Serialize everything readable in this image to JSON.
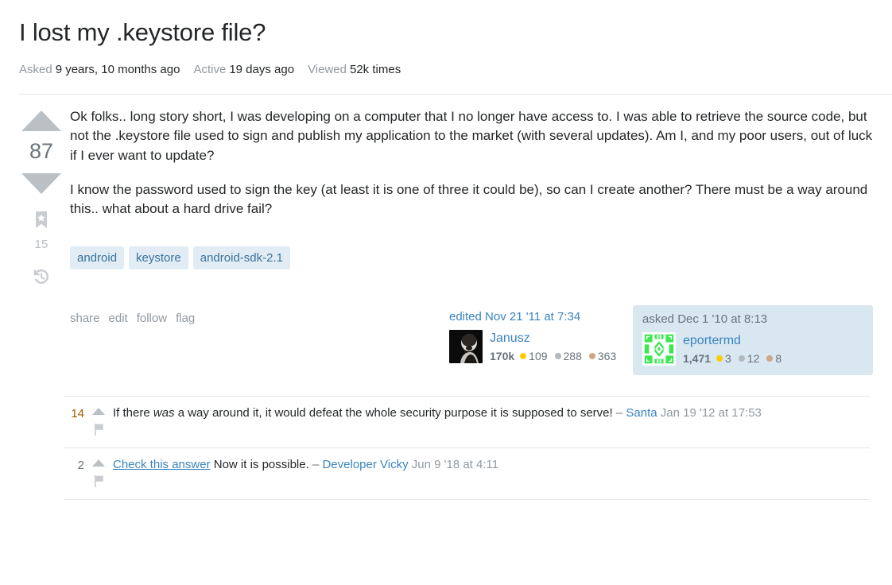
{
  "header": {
    "title": "I lost my .keystore file?",
    "stats": [
      {
        "label": "Asked",
        "value": "9 years, 10 months ago"
      },
      {
        "label": "Active",
        "value": "19 days ago"
      },
      {
        "label": "Viewed",
        "value": "52k times"
      }
    ]
  },
  "vote": {
    "score": "87",
    "bookmark_count": "15",
    "up_icon": "upvote-arrow-icon",
    "down_icon": "downvote-arrow-icon",
    "bookmark_icon": "bookmark-star-icon",
    "history_icon": "history-clock-icon"
  },
  "post": {
    "paragraphs": [
      "Ok folks.. long story short, I was developing on a computer that I no longer have access to. I was able to retrieve the source code, but not the .keystore file used to sign and publish my application to the market (with several updates). Am I, and my poor users, out of luck if I ever want to update?",
      "I know the password used to sign the key (at least it is one of three it could be), so can I create another? There must be a way around this.. what about a hard drive fail?"
    ],
    "tags": [
      "android",
      "keystore",
      "android-sdk-2.1"
    ],
    "actions": [
      "share",
      "edit",
      "follow",
      "flag"
    ]
  },
  "editor_card": {
    "action_time": "edited Nov 21 '11 at 7:34",
    "username": "Janusz",
    "reputation": "170k",
    "badges": [
      {
        "type": "gold",
        "count": "109"
      },
      {
        "type": "silver",
        "count": "288"
      },
      {
        "type": "bronze",
        "count": "363"
      }
    ],
    "avatar": "photo-avatar"
  },
  "owner_card": {
    "action_time": "asked Dec 1 '10 at 8:13",
    "username": "eportermd",
    "reputation": "1,471",
    "badges": [
      {
        "type": "gold",
        "count": "3"
      },
      {
        "type": "silver",
        "count": "12"
      },
      {
        "type": "bronze",
        "count": "8"
      }
    ],
    "avatar": "identicon-avatar",
    "avatar_color": "#3ce84f"
  },
  "comments": [
    {
      "score": "14",
      "score_voted": true,
      "text_before_italic": "If there ",
      "italic": "was",
      "text_after_italic": " a way around it, it would defeat the whole security purpose it is supposed to serve!",
      "dash": "–",
      "user": "Santa",
      "date": "Jan 19 '12 at 17:53",
      "link_text": "",
      "vote_icon": "comment-upvote-icon",
      "flag_icon": "comment-flag-icon"
    },
    {
      "score": "2",
      "score_voted": false,
      "link_text": "Check this answer",
      "text_after_link": " Now it is possible.",
      "dash": "–",
      "user": "Developer Vicky",
      "date": "Jun 9 '18 at 4:11",
      "vote_icon": "comment-upvote-icon",
      "flag_icon": "comment-flag-icon"
    }
  ],
  "colors": {
    "link": "#3b84c0",
    "tag_bg": "#e1ecf4",
    "tag_text": "#39739d",
    "owner_card_bg": "#d9e7f1",
    "gold": "#ffcc01",
    "silver": "#b4b8bc",
    "bronze": "#d1a684",
    "muted": "#9199a1"
  }
}
